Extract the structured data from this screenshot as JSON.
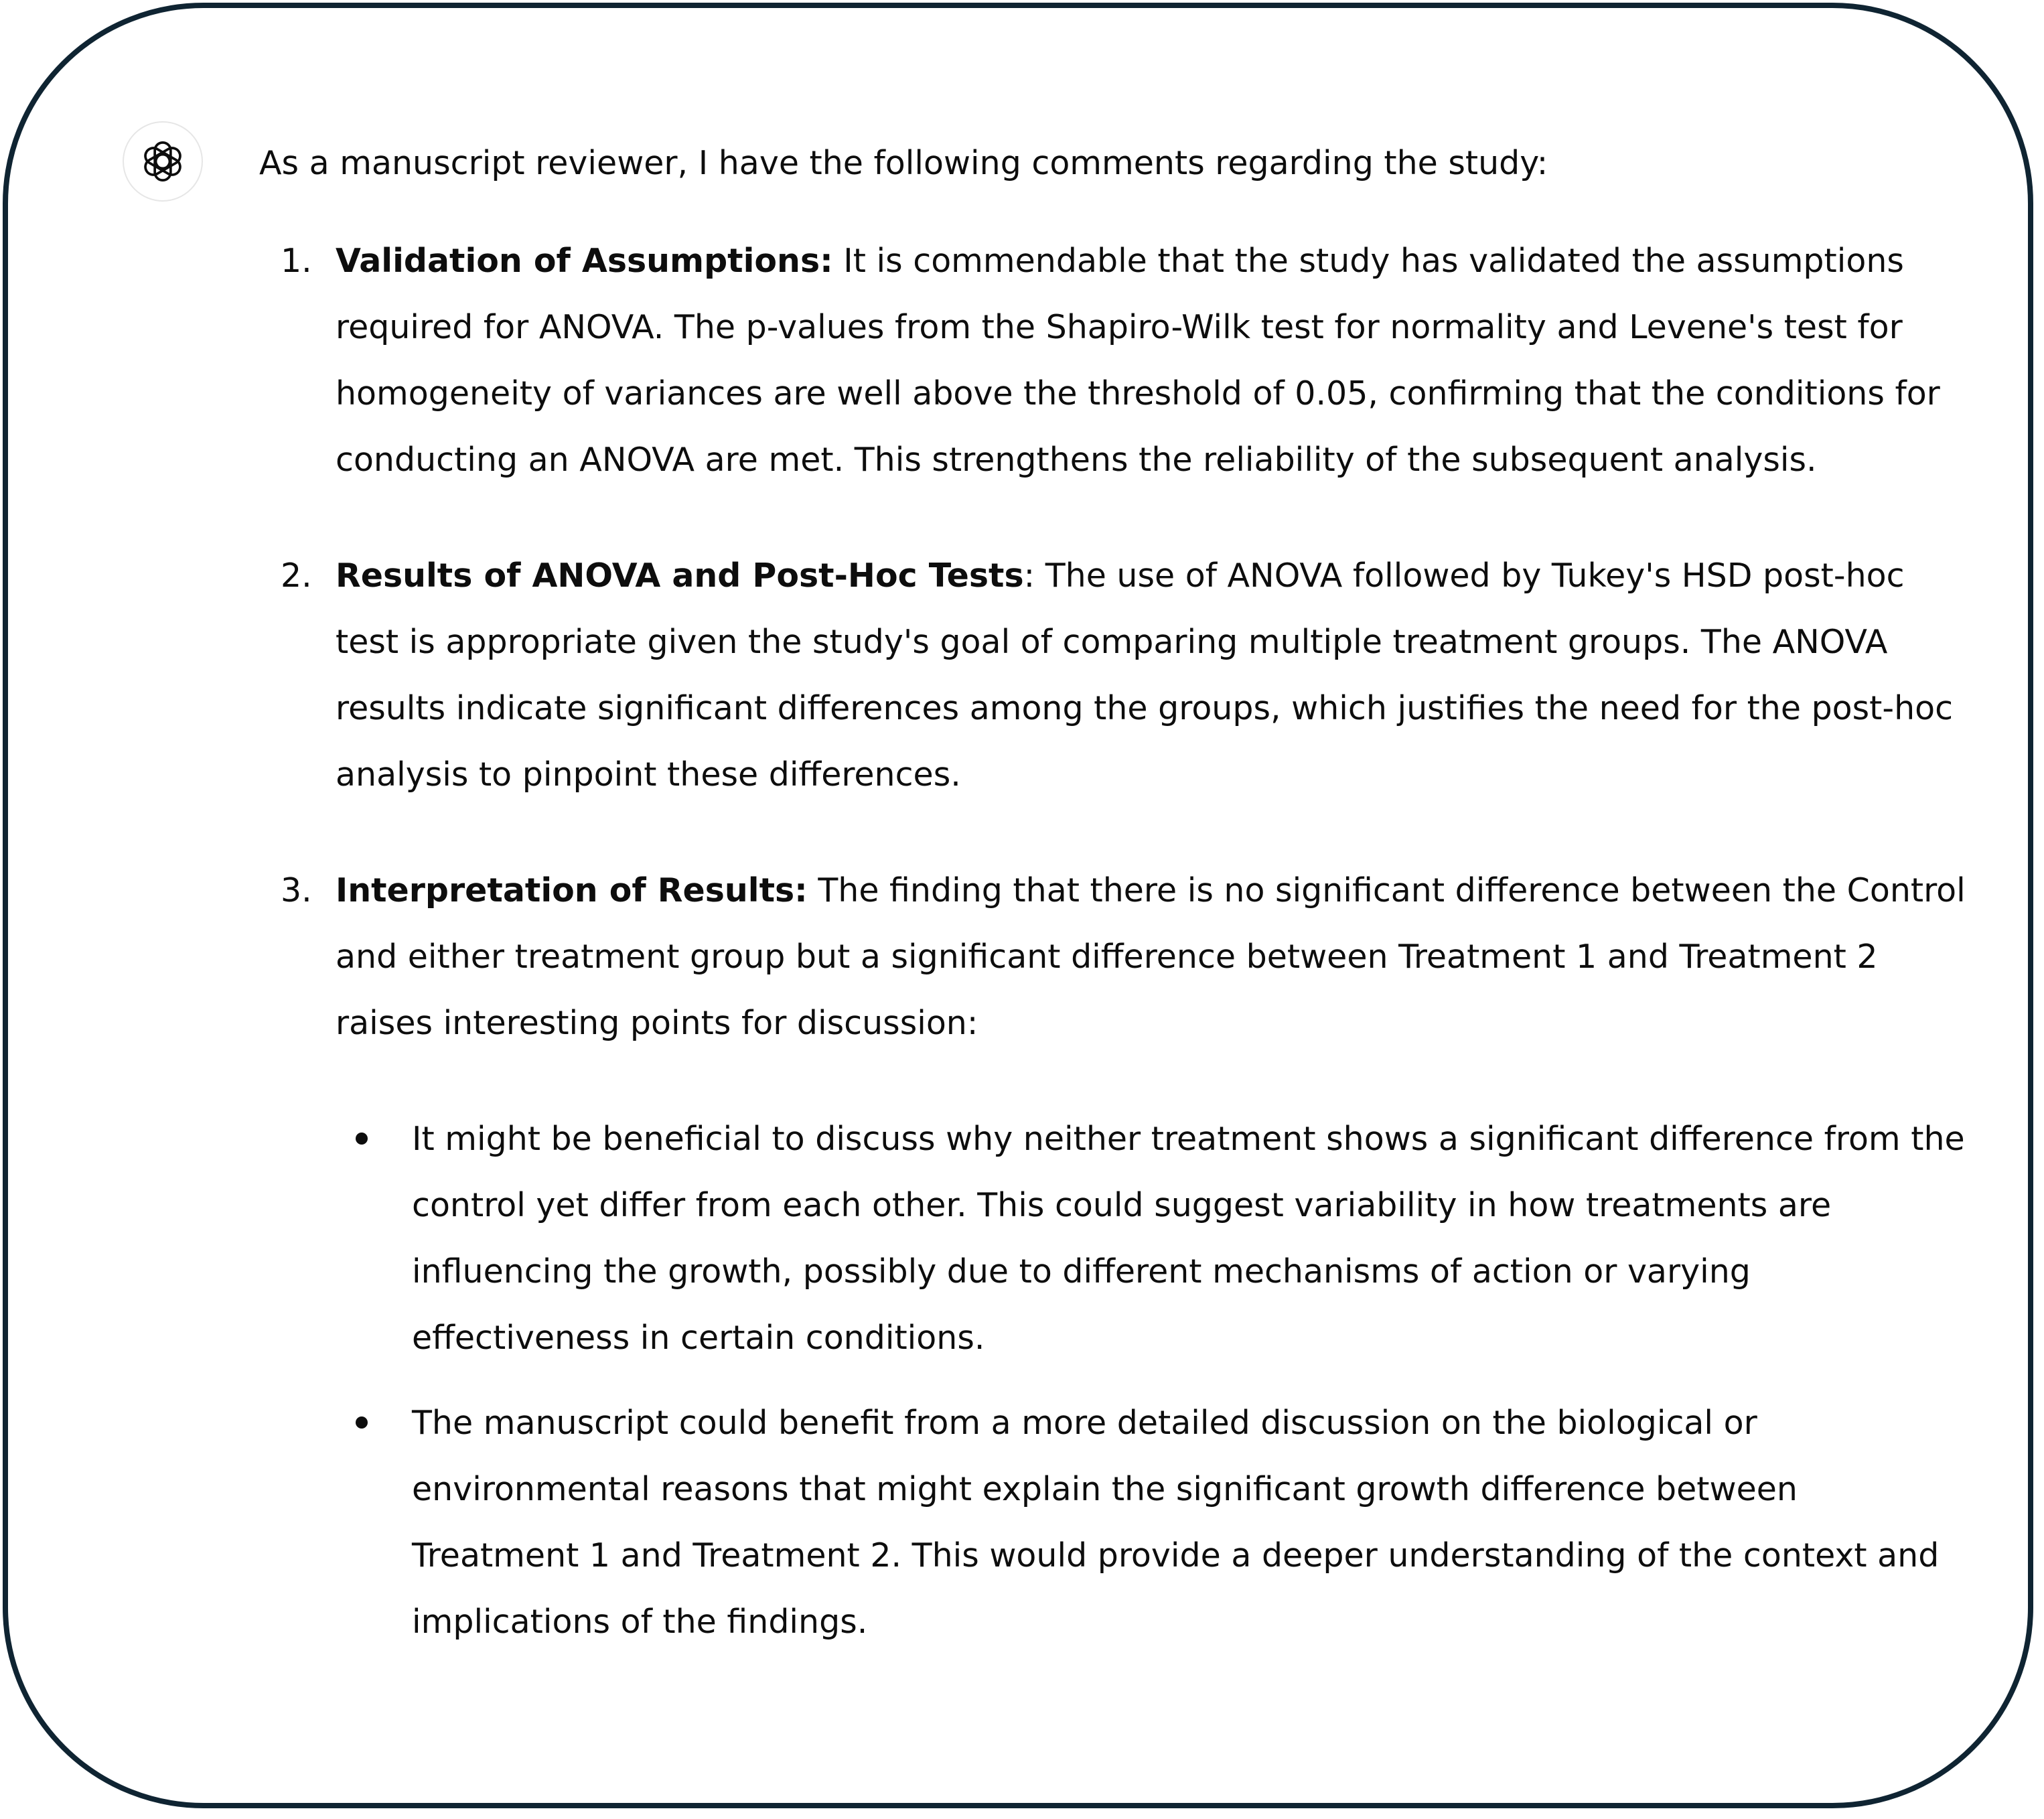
{
  "assistant": {
    "icon": "openai-logo-icon"
  },
  "message": {
    "intro": "As a manuscript reviewer, I have the following comments regarding the study:",
    "points": [
      {
        "number": "1.",
        "title": "Validation of Assumptions:",
        "text": " It is commendable that the study has validated the assumptions required for ANOVA. The p-values from the Shapiro-Wilk test for normality and Levene's test for homogeneity of variances are well above the threshold of 0.05, confirming that the conditions for conducting an ANOVA are met. This strengthens the reliability of the subsequent analysis."
      },
      {
        "number": "2.",
        "title": "Results of ANOVA and Post-Hoc Tests",
        "text": ": The use of ANOVA followed by Tukey's HSD post-hoc test is appropriate given the study's goal of comparing multiple treatment groups. The ANOVA results indicate significant differences among the groups, which justifies the need for the post-hoc analysis to pinpoint these differences."
      },
      {
        "number": "3.",
        "title": "Interpretation of Results:",
        "text": " The finding that there is no significant difference between the Control and either treatment group but a significant difference between Treatment 1 and Treatment 2 raises interesting points for discussion:",
        "bullets": [
          "It might be beneficial to discuss why neither treatment shows a significant difference from the control yet differ from each other. This could suggest variability in how treatments are influencing the growth, possibly due to different mechanisms of action or varying effectiveness in certain conditions.",
          "The manuscript could benefit from a more detailed discussion on the biological or environmental reasons that might explain the significant growth difference between Treatment 1 and Treatment 2. This would provide a deeper understanding of the context and implications of the findings."
        ]
      }
    ]
  }
}
